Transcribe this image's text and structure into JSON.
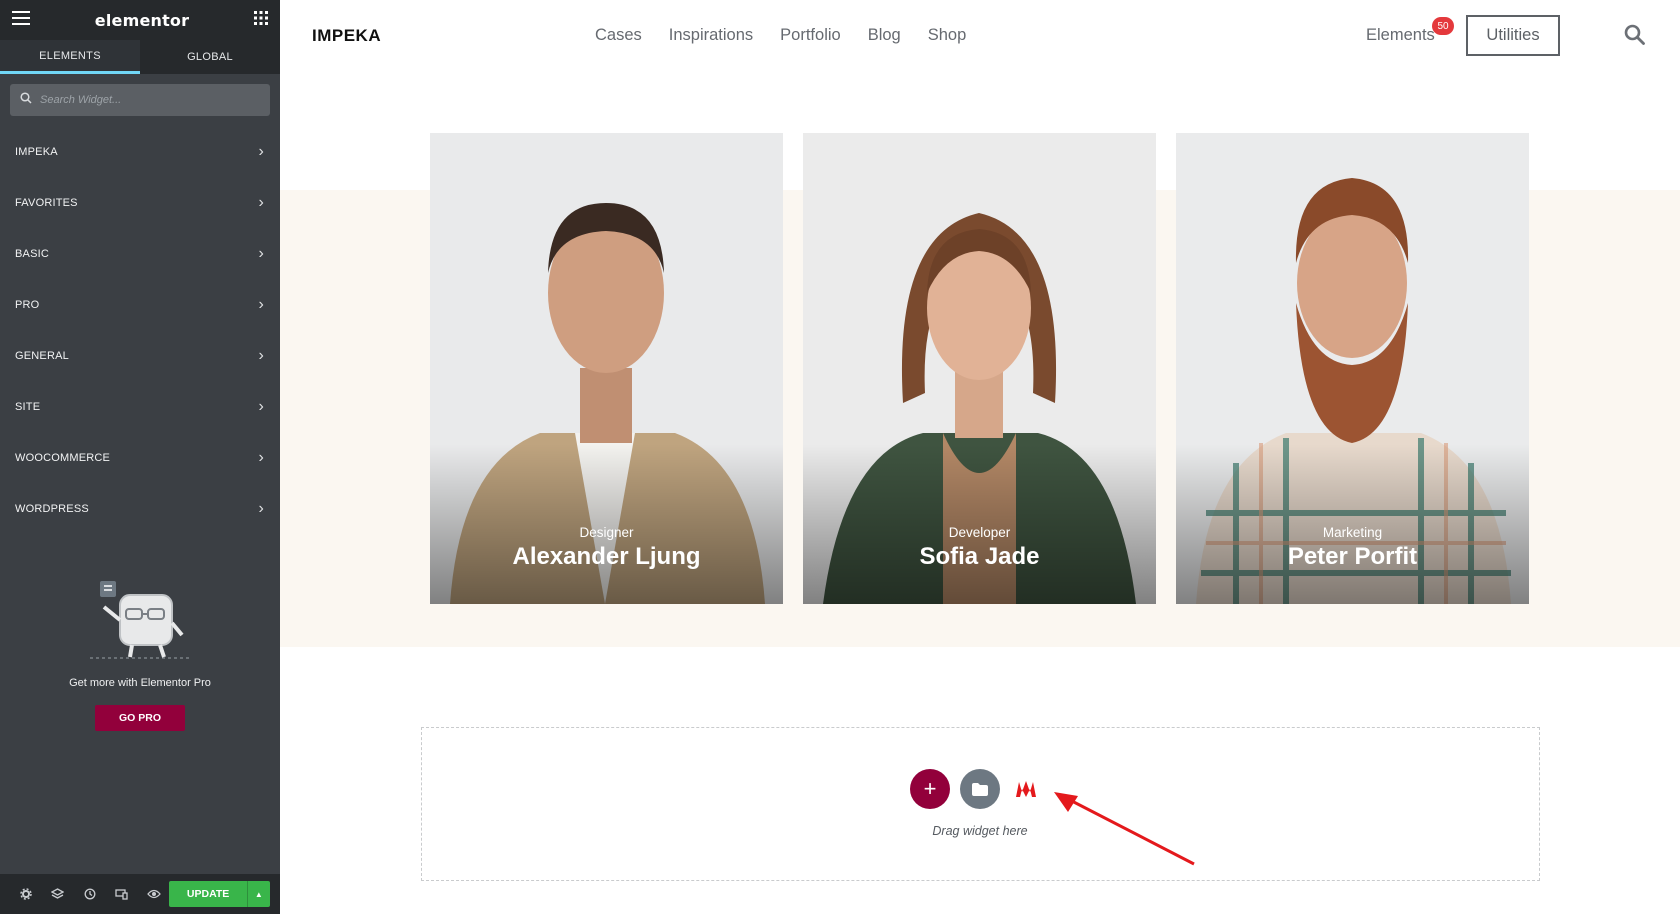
{
  "sidebar": {
    "logo": "elementor",
    "tabs": [
      {
        "label": "ELEMENTS",
        "active": true
      },
      {
        "label": "GLOBAL",
        "active": false
      }
    ],
    "search_placeholder": "Search Widget...",
    "categories": [
      {
        "label": "IMPEKA"
      },
      {
        "label": "FAVORITES"
      },
      {
        "label": "BASIC"
      },
      {
        "label": "PRO"
      },
      {
        "label": "GENERAL"
      },
      {
        "label": "SITE"
      },
      {
        "label": "WOOCOMMERCE"
      },
      {
        "label": "WORDPRESS"
      }
    ],
    "promo": {
      "text": "Get more with Elementor Pro",
      "button": "GO PRO"
    },
    "footer": {
      "update_label": "UPDATE",
      "icons": [
        "settings-icon",
        "layers-icon",
        "history-icon",
        "responsive-icon",
        "preview-icon"
      ]
    }
  },
  "site": {
    "brand": "IMPEKA",
    "menu": [
      "Cases",
      "Inspirations",
      "Portfolio",
      "Blog",
      "Shop"
    ],
    "elements_label": "Elements",
    "elements_badge": "50",
    "utilities_label": "Utilities",
    "team": [
      {
        "role": "Designer",
        "name": "Alexander Ljung"
      },
      {
        "role": "Developer",
        "name": "Sofia Jade"
      },
      {
        "role": "Marketing",
        "name": "Peter Porfit"
      }
    ],
    "dropzone_text": "Drag widget here"
  },
  "colors": {
    "sidebar_bg": "#3b3f44",
    "sidebar_header": "#26292c",
    "active_tab": "#71d7f7",
    "brand_accent": "#92003b",
    "update_green": "#39b54a",
    "badge_red": "#e4393c",
    "band_bg": "#fbf7f1",
    "arrow_red": "#e4191c"
  }
}
